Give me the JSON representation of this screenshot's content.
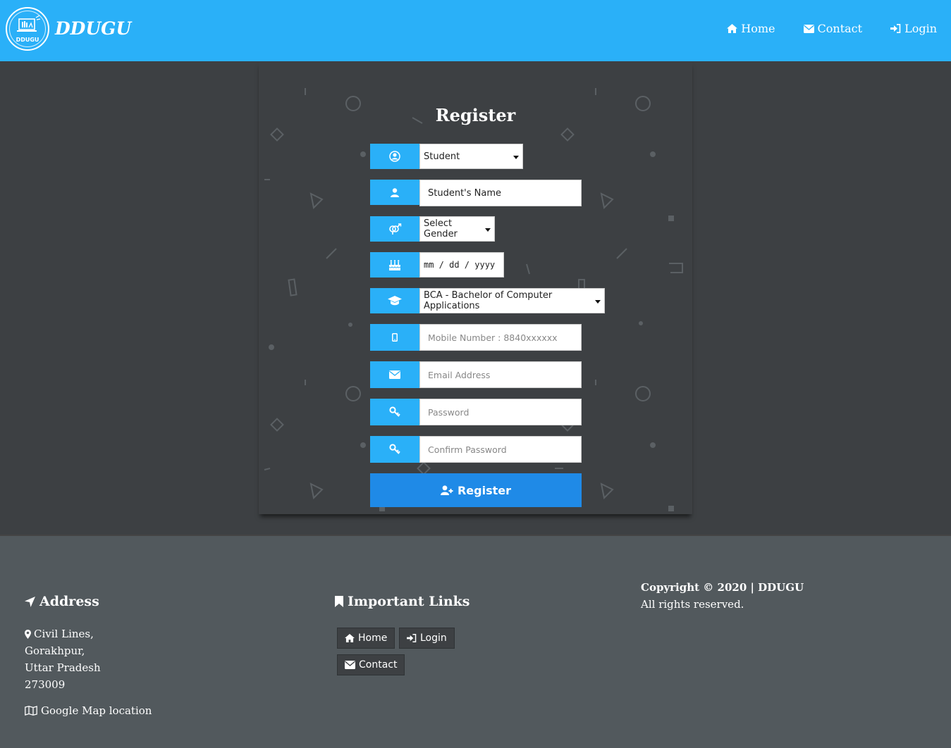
{
  "header": {
    "logo_text": "DDUGU",
    "brand": "DDUGU",
    "nav": [
      {
        "label": "Home",
        "icon": "home-icon"
      },
      {
        "label": "Contact",
        "icon": "envelope-icon"
      },
      {
        "label": "Login",
        "icon": "sign-in-icon"
      }
    ]
  },
  "form": {
    "title": "Register",
    "role_value": "Student",
    "name_value": "Student's Name",
    "gender_value": "Select Gender",
    "dob_placeholder": "mm / dd / yyyy",
    "course_value": "BCA - Bachelor of Computer Applications",
    "mobile_placeholder": "Mobile Number : 8840xxxxxx",
    "email_placeholder": "Email Address",
    "password_placeholder": "Password",
    "confirm_placeholder": "Confirm Password",
    "submit_label": "Register"
  },
  "footer": {
    "address_title": "Address",
    "address_lines": [
      "Civil Lines,",
      "Gorakhpur,",
      "Uttar Pradesh",
      "273009"
    ],
    "map_label": "Google Map location",
    "links_title": "Important Links",
    "links": [
      "Home",
      "Login",
      "Contact"
    ],
    "copyright": "Copyright © 2020 | DDUGU",
    "rights": "All rights reserved."
  },
  "colors": {
    "accent": "#2ab0f8",
    "button": "#1f8ae7",
    "background": "#3d4043",
    "footer": "#52595d"
  }
}
